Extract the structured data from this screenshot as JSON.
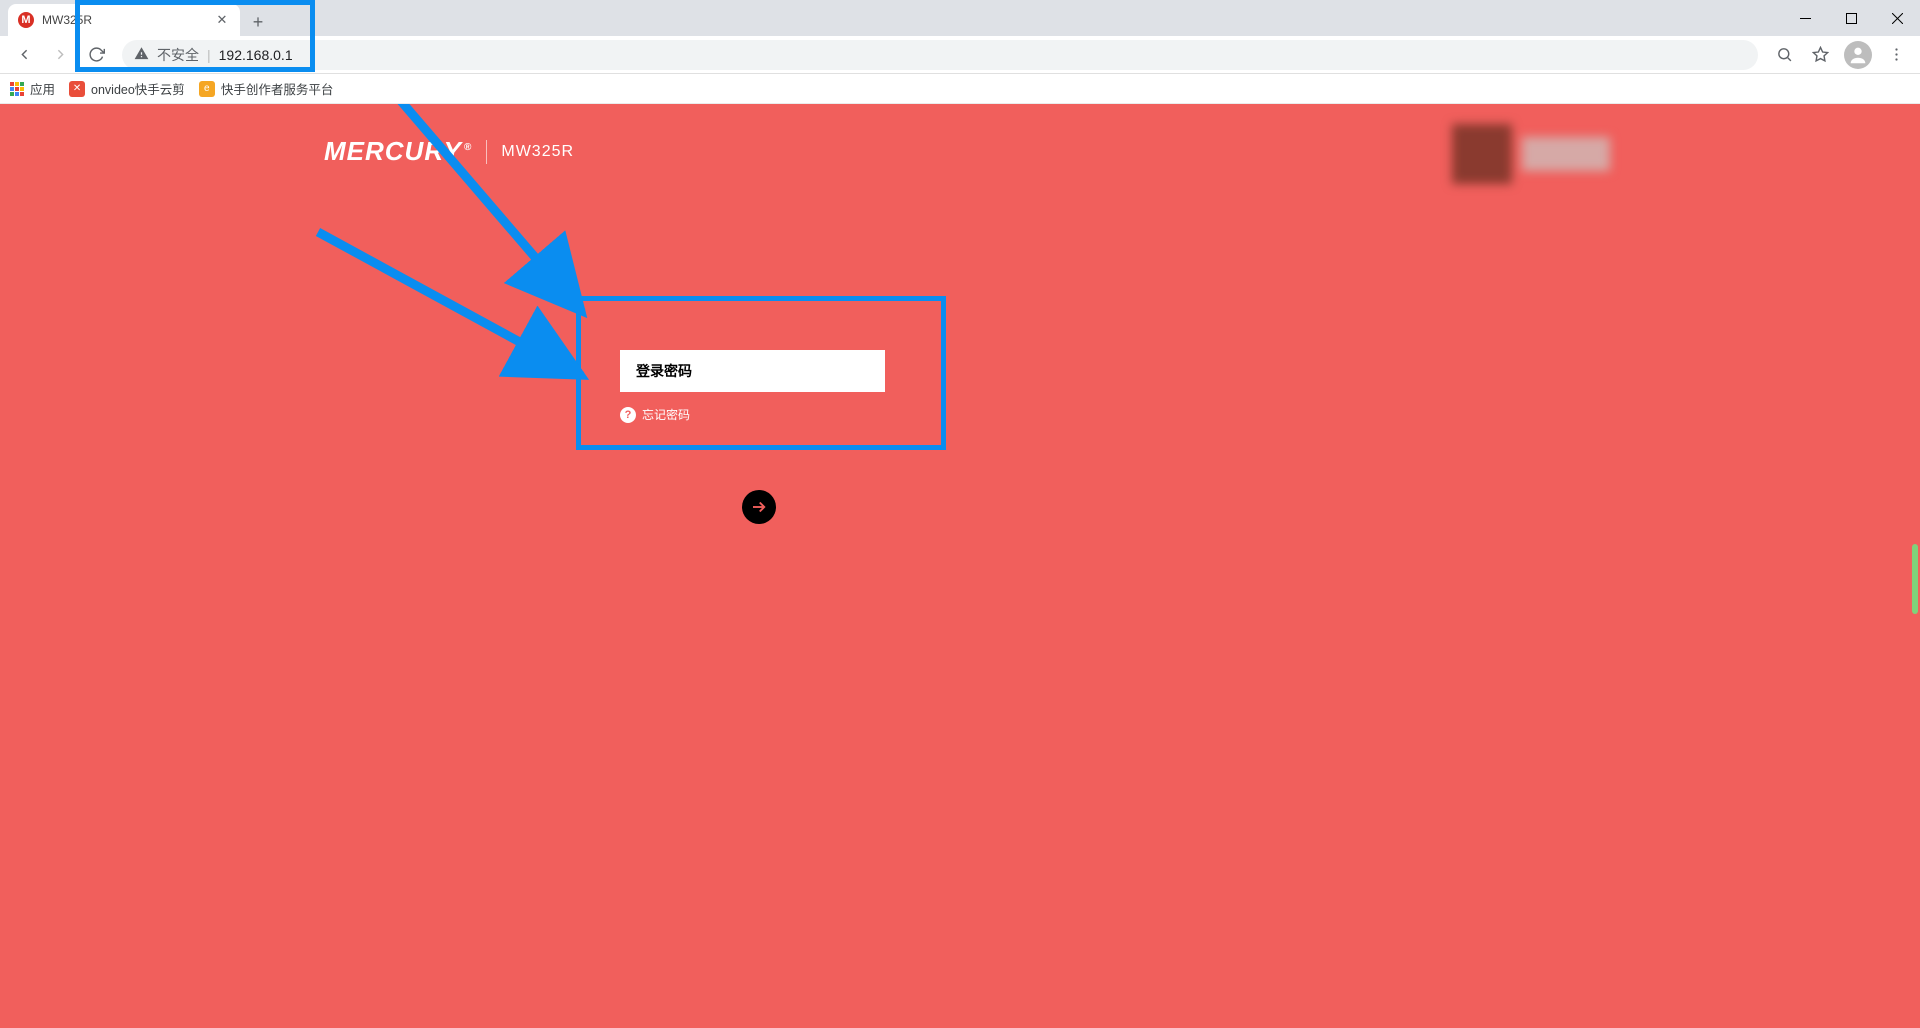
{
  "window": {
    "tab_title": "MW325R",
    "tab_favicon_letter": "M"
  },
  "toolbar": {
    "security_label": "不安全",
    "url": "192.168.0.1"
  },
  "bookmarks": {
    "apps_label": "应用",
    "items": [
      {
        "label": "onvideo快手云剪",
        "color": "#e94e3a"
      },
      {
        "label": "快手创作者服务平台",
        "color": "#f5a623"
      }
    ]
  },
  "brand": {
    "logo_text": "MERCURY",
    "model": "MW325R"
  },
  "login": {
    "password_placeholder": "登录密码",
    "forgot_label": "忘记密码"
  },
  "colors": {
    "page_bg": "#f15f5c",
    "annotation": "#0a8df0"
  }
}
